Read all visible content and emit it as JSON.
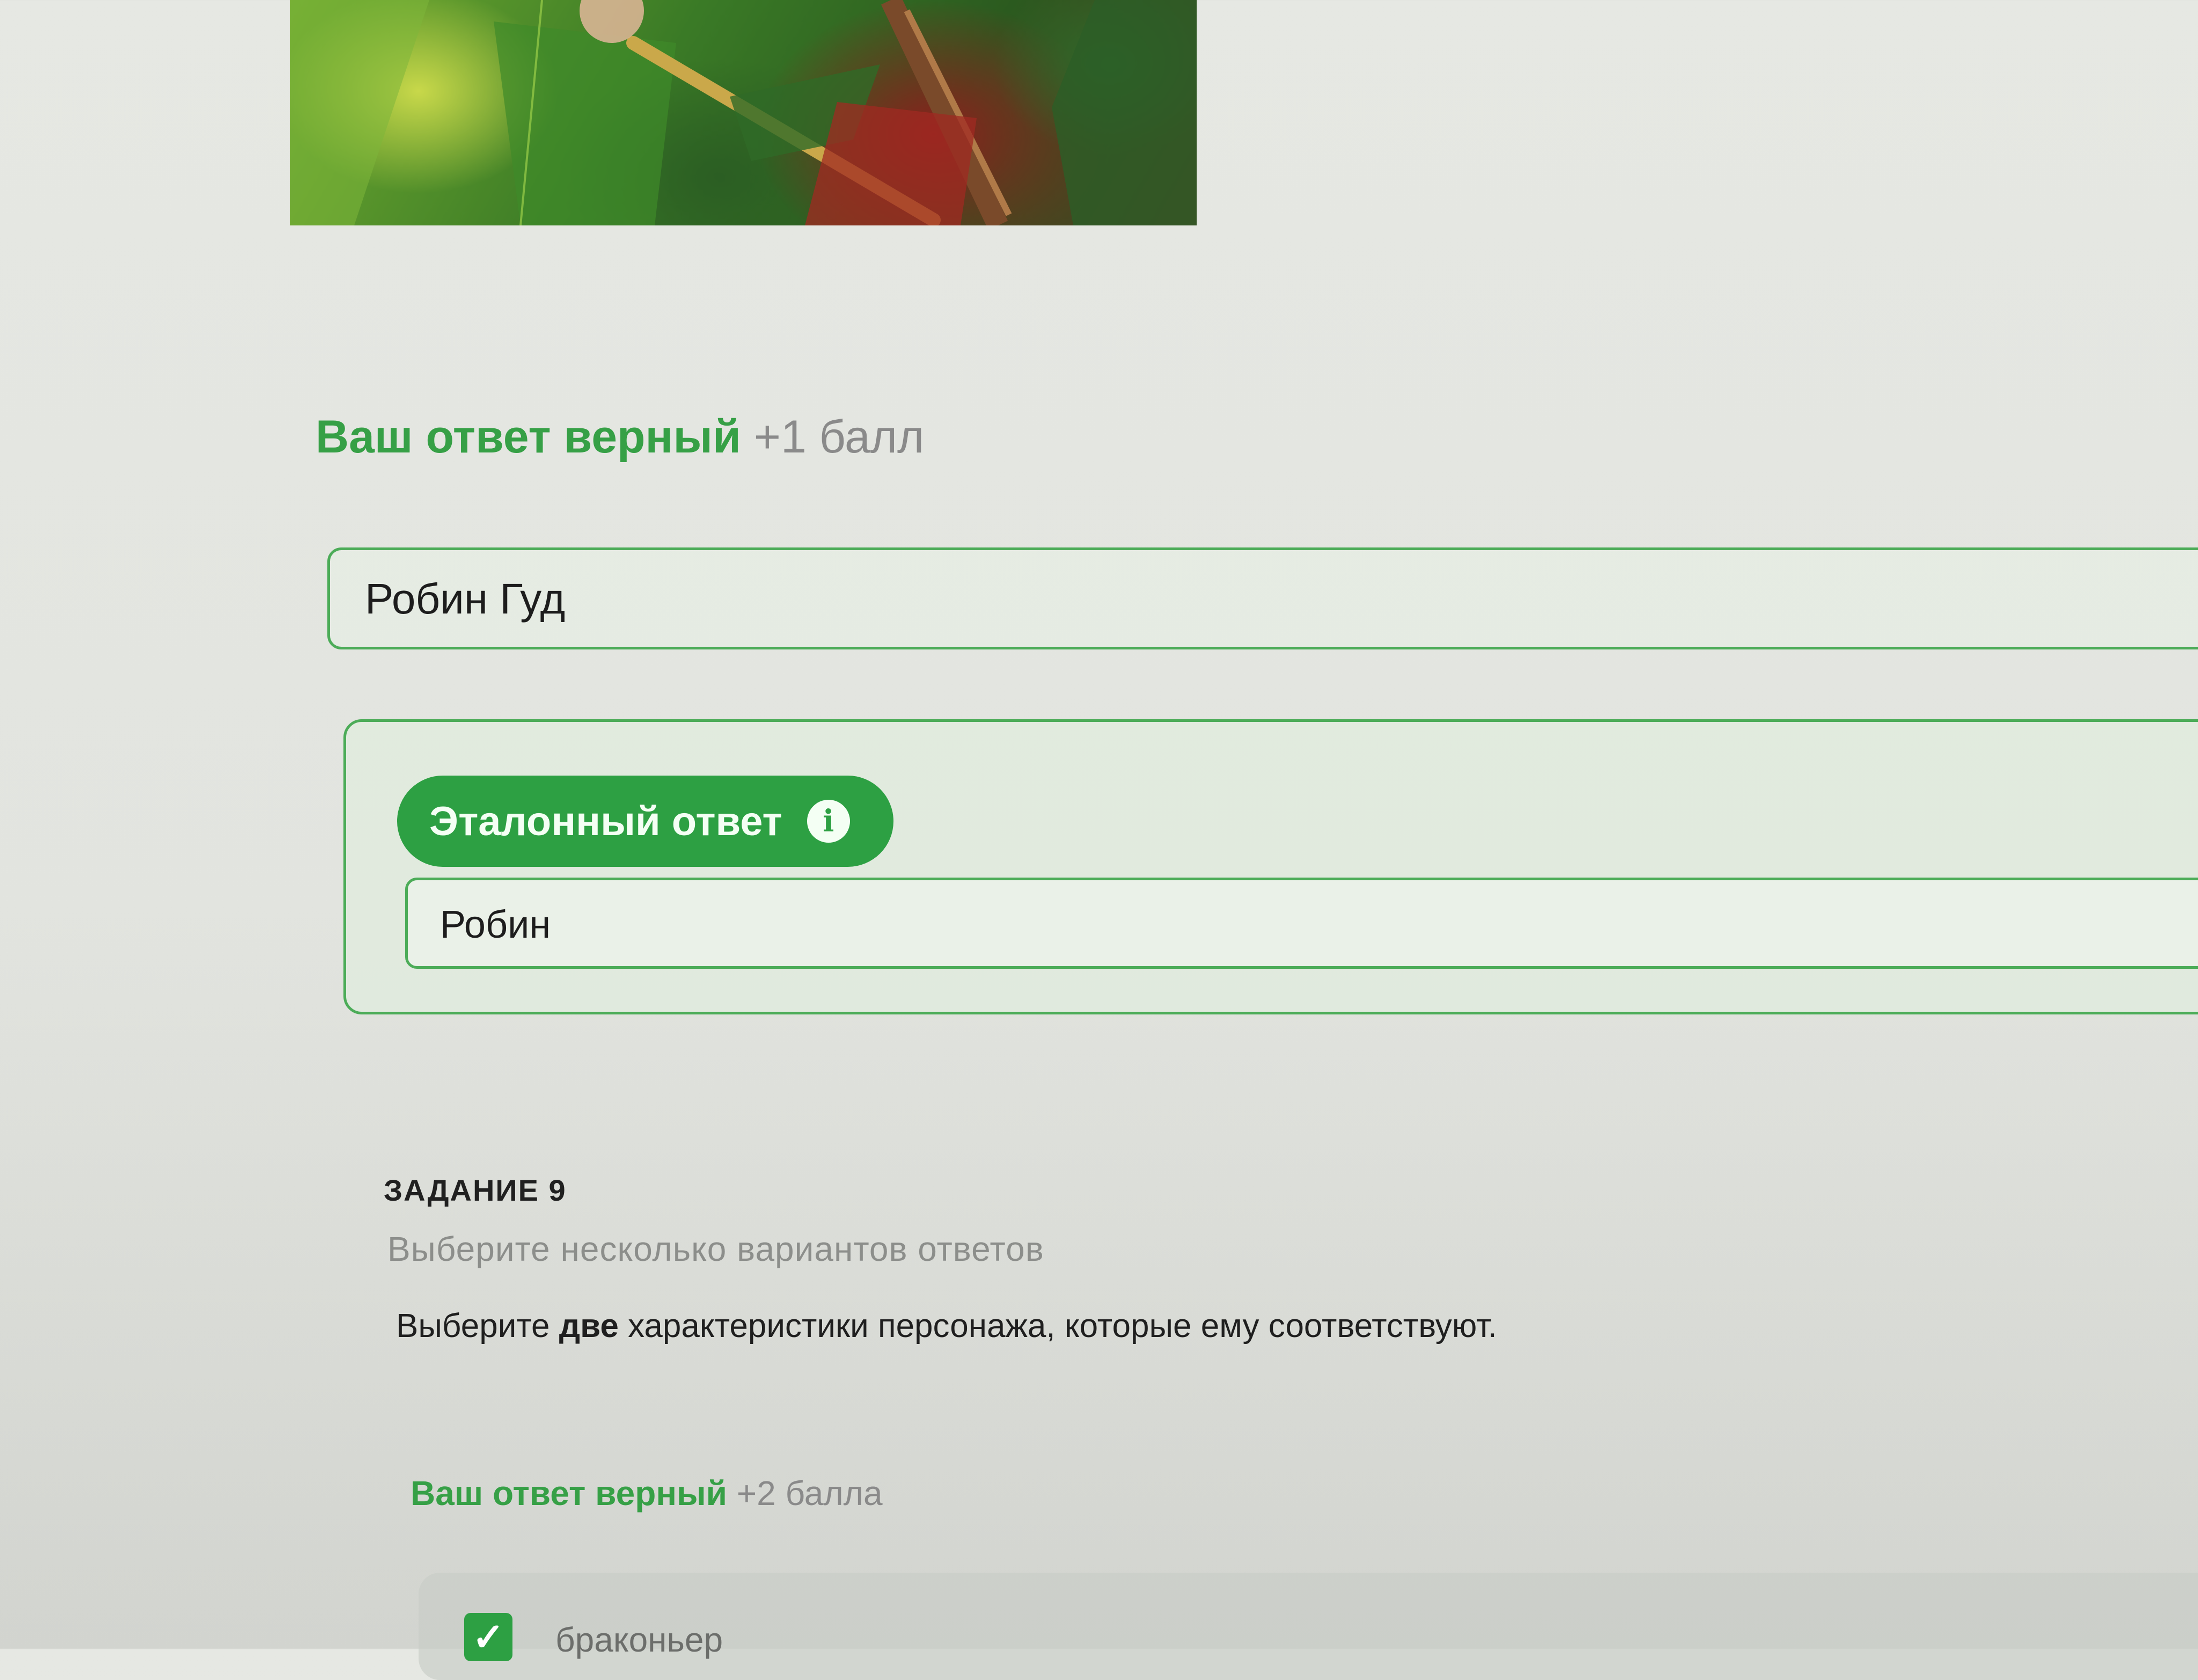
{
  "task8": {
    "result_text": "Ваш ответ верный",
    "result_points": "+1 балл",
    "user_answer": "Робин Гуд",
    "reference_label": "Эталонный ответ",
    "reference_info_icon": "i",
    "reference_answer": "Робин"
  },
  "task9": {
    "title": "ЗАДАНИЕ 9",
    "hint": "Выберите несколько вариантов ответов",
    "question_prefix": "Выберите",
    "question_bold": "две",
    "question_suffix": "характеристики персонажа, которые ему соответствуют.",
    "result_text": "Ваш ответ верный",
    "result_points": "+2 балла",
    "options": [
      {
        "label": "браконьер",
        "checked": true
      }
    ]
  },
  "colors": {
    "accent_green": "#2da043",
    "border_green": "#4cac58",
    "result_green": "#36a046",
    "muted_gray": "#8c8e8b"
  },
  "icons": {
    "info": "info-icon",
    "check": "checkmark-icon"
  }
}
